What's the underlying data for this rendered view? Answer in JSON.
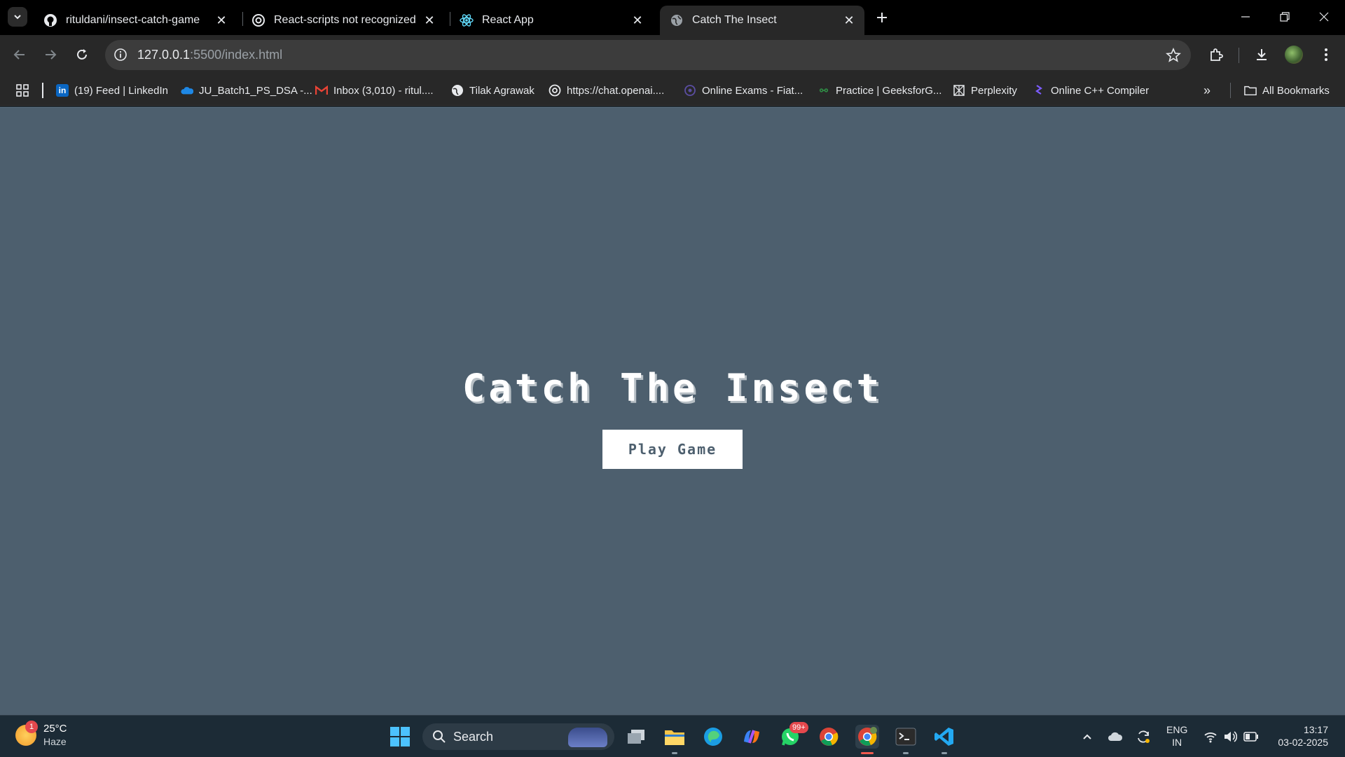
{
  "tabs": [
    {
      "title": "rituldani/insect-catch-game",
      "favicon": "github-icon"
    },
    {
      "title": "React-scripts not recognized",
      "favicon": "openai-icon"
    },
    {
      "title": "React App",
      "favicon": "react-icon"
    },
    {
      "title": "Catch The Insect",
      "favicon": "globe-icon",
      "active": true
    }
  ],
  "omnibox": {
    "host": "127.0.0.1",
    "path": ":5500/index.html"
  },
  "bookmarks": [
    {
      "label": "(19) Feed | LinkedIn",
      "icon": "linkedin-icon"
    },
    {
      "label": "JU_Batch1_PS_DSA -...",
      "icon": "onedrive-icon"
    },
    {
      "label": "Inbox (3,010) - ritul....",
      "icon": "gmail-icon"
    },
    {
      "label": "Tilak Agrawak",
      "icon": "chrome-globe-icon"
    },
    {
      "label": "https://chat.openai....",
      "icon": "openai-icon"
    },
    {
      "label": "Online Exams - Fiat...",
      "icon": "fiat-icon"
    },
    {
      "label": "Practice | GeeksforG...",
      "icon": "geeksforgeeks-icon"
    },
    {
      "label": "Perplexity",
      "icon": "perplexity-icon"
    },
    {
      "label": "Online C++ Compiler",
      "icon": "compiler-icon"
    }
  ],
  "bookmarks_all": "All Bookmarks",
  "page": {
    "title": "Catch The Insect",
    "play_button": "Play Game"
  },
  "taskbar": {
    "weather": {
      "temp": "25°C",
      "condition": "Haze",
      "badge": "1"
    },
    "search_label": "Search",
    "whatsapp_badge": "99+",
    "lang_top": "ENG",
    "lang_bottom": "IN",
    "time": "13:17",
    "date": "03-02-2025"
  },
  "colors": {
    "page_background": "#4d5f6e",
    "button_background": "#ffffff",
    "taskbar_background": "#1c2b36"
  }
}
